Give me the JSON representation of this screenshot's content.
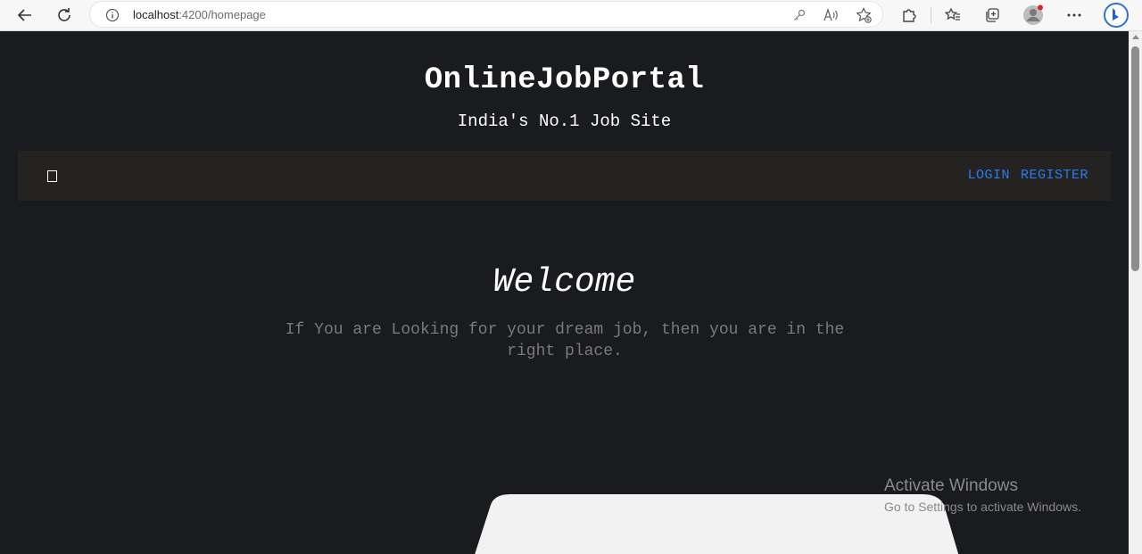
{
  "browser": {
    "url_host": "localhost",
    "url_path": ":4200/homepage"
  },
  "site": {
    "title": "OnlineJobPortal",
    "tagline": "India's No.1 Job Site"
  },
  "navbar": {
    "links": [
      {
        "label": "LOGIN"
      },
      {
        "label": "REGISTER"
      }
    ]
  },
  "hero": {
    "heading": "Welcome",
    "lead": "If You are Looking for your dream job, then you are in the right place."
  },
  "watermark": {
    "line1": "Activate Windows",
    "line2": "Go to Settings to activate Windows."
  },
  "colors": {
    "page_bg": "#1a1b1e",
    "navbar_bg": "#242321",
    "link": "#2b7bea",
    "lead_text": "#7a7a7a"
  }
}
